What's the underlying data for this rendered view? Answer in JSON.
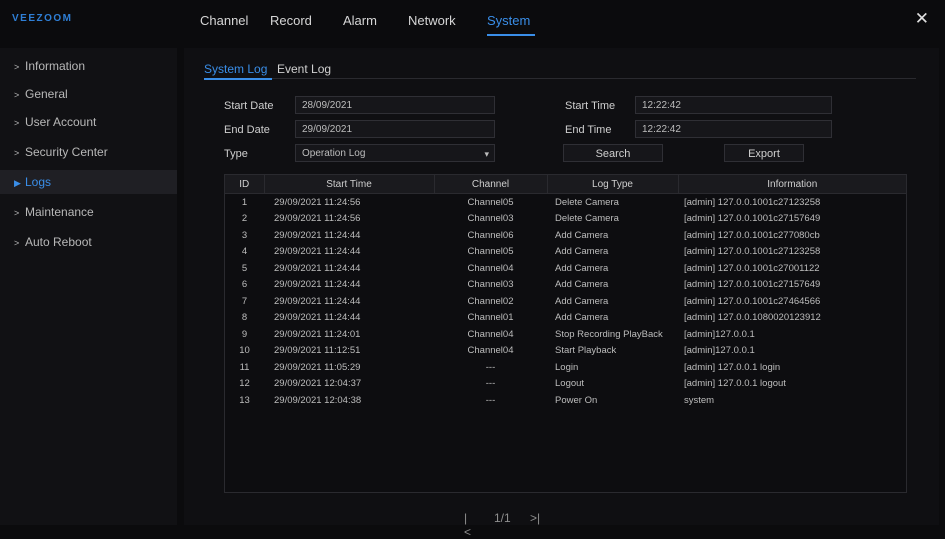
{
  "app": {
    "logo": "VEEZOOM",
    "close_icon": "close-icon"
  },
  "nav": [
    {
      "label": "Channel",
      "active": false
    },
    {
      "label": "Record",
      "active": false
    },
    {
      "label": "Alarm",
      "active": false
    },
    {
      "label": "Network",
      "active": false
    },
    {
      "label": "System",
      "active": true
    }
  ],
  "sidebar": {
    "items": [
      {
        "label": "Information",
        "active": false
      },
      {
        "label": "General",
        "active": false
      },
      {
        "label": "User Account",
        "active": false
      },
      {
        "label": "Security Center",
        "active": false
      },
      {
        "label": "Logs",
        "active": true
      },
      {
        "label": "Maintenance",
        "active": false
      },
      {
        "label": "Auto Reboot",
        "active": false
      }
    ]
  },
  "subtabs": [
    {
      "label": "System Log",
      "active": true
    },
    {
      "label": "Event Log",
      "active": false
    }
  ],
  "filters": {
    "start_date_label": "Start Date",
    "start_date": "28/09/2021",
    "end_date_label": "End Date",
    "end_date": "29/09/2021",
    "type_label": "Type",
    "type_value": "Operation Log",
    "start_time_label": "Start Time",
    "start_time": "12:22:42",
    "end_time_label": "End Time",
    "end_time": "12:22:42",
    "search_label": "Search",
    "export_label": "Export"
  },
  "table": {
    "headers": [
      "ID",
      "Start Time",
      "Channel",
      "Log Type",
      "Information"
    ],
    "rows": [
      [
        "1",
        "29/09/2021 11:24:56",
        "Channel05",
        "Delete Camera",
        "[admin] 127.0.0.1001c27123258"
      ],
      [
        "2",
        "29/09/2021 11:24:56",
        "Channel03",
        "Delete Camera",
        "[admin] 127.0.0.1001c27157649"
      ],
      [
        "3",
        "29/09/2021 11:24:44",
        "Channel06",
        "Add Camera",
        "[admin] 127.0.0.1001c277080cb"
      ],
      [
        "4",
        "29/09/2021 11:24:44",
        "Channel05",
        "Add Camera",
        "[admin] 127.0.0.1001c27123258"
      ],
      [
        "5",
        "29/09/2021 11:24:44",
        "Channel04",
        "Add Camera",
        "[admin] 127.0.0.1001c27001122"
      ],
      [
        "6",
        "29/09/2021 11:24:44",
        "Channel03",
        "Add Camera",
        "[admin] 127.0.0.1001c27157649"
      ],
      [
        "7",
        "29/09/2021 11:24:44",
        "Channel02",
        "Add Camera",
        "[admin] 127.0.0.1001c27464566"
      ],
      [
        "8",
        "29/09/2021 11:24:44",
        "Channel01",
        "Add Camera",
        "[admin] 127.0.0.1080020123912"
      ],
      [
        "9",
        "29/09/2021 11:24:01",
        "Channel04",
        "Stop Recording PlayBack",
        "[admin]127.0.0.1"
      ],
      [
        "10",
        "29/09/2021 11:12:51",
        "Channel04",
        "Start Playback",
        "[admin]127.0.0.1"
      ],
      [
        "11",
        "29/09/2021 11:05:29",
        "---",
        "Login",
        "[admin] 127.0.0.1 login"
      ],
      [
        "12",
        "29/09/2021 12:04:37",
        "---",
        "Logout",
        "[admin] 127.0.0.1 logout"
      ],
      [
        "13",
        "29/09/2021 12:04:38",
        "---",
        "Power On",
        "system"
      ]
    ]
  },
  "pagination": {
    "first": "|<",
    "page": "1/1",
    "last": ">|"
  }
}
